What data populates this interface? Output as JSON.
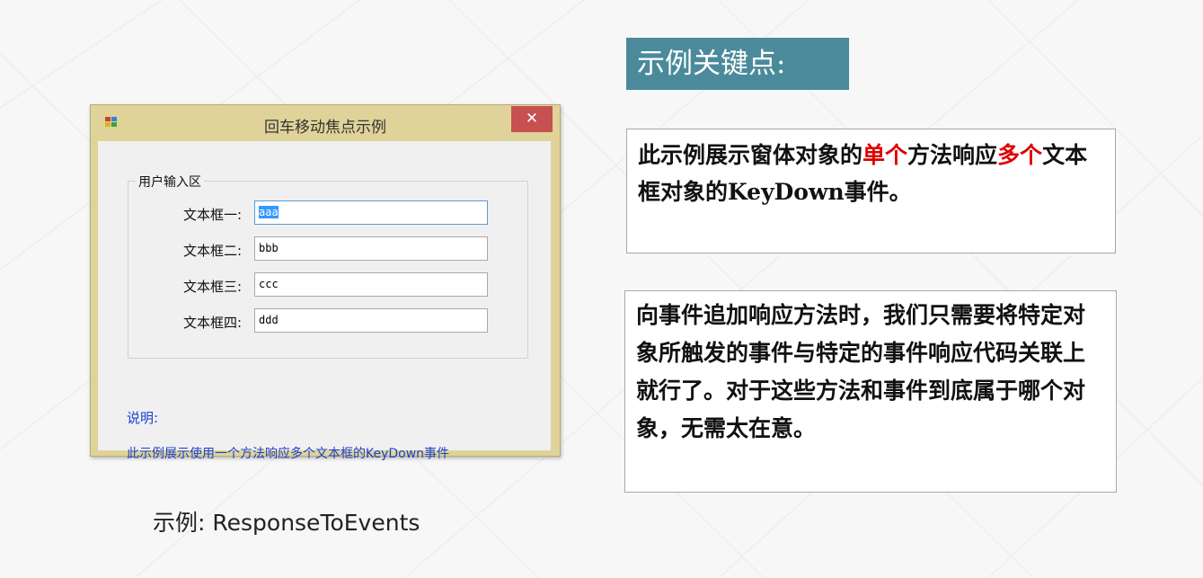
{
  "window": {
    "title": "回车移动焦点示例",
    "close_glyph": "✕",
    "group_label": "用户输入区",
    "rows": [
      {
        "label": "文本框一:",
        "value": "aaa"
      },
      {
        "label": "文本框二:",
        "value": "bbb"
      },
      {
        "label": "文本框三:",
        "value": "ccc"
      },
      {
        "label": "文本框四:",
        "value": "ddd"
      }
    ],
    "note_title": "说明:",
    "note_body": "此示例展示使用一个方法响应多个文本框的KeyDown事件"
  },
  "caption": "示例: ResponseToEvents",
  "key_points": {
    "header": "示例关键点:",
    "card1": {
      "part1": "此示例展示窗体对象的",
      "highlight1": "单个",
      "part2": "方法响应",
      "highlight2": "多个",
      "part3": "文本框对象的KeyDown事件。"
    },
    "card2": "向事件追加响应方法时，我们只需要将特定对象所触发的事件与特定的事件响应代码关联上就行了。对于这些方法和事件到底属于哪个对象，无需太在意。"
  },
  "colors": {
    "header_bg": "#4a8a9b",
    "highlight": "#e00000",
    "window_frame": "#dfd39a",
    "close_button": "#c75050",
    "note_text": "#1a3fd0"
  },
  "icons": [
    "app-icon",
    "close-icon"
  ]
}
